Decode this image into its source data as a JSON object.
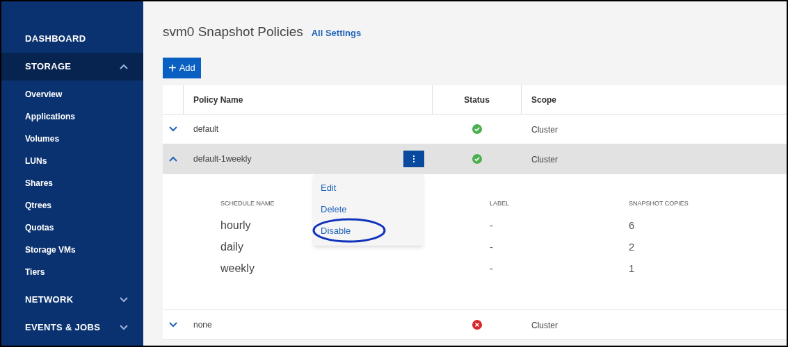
{
  "sidebar": {
    "sections": [
      {
        "label": "DASHBOARD",
        "selected": false
      },
      {
        "label": "STORAGE",
        "selected": true,
        "expanded": true,
        "items": [
          "Overview",
          "Applications",
          "Volumes",
          "LUNs",
          "Shares",
          "Qtrees",
          "Quotas",
          "Storage VMs",
          "Tiers"
        ]
      },
      {
        "label": "NETWORK",
        "selected": false,
        "expanded": false
      },
      {
        "label": "EVENTS & JOBS",
        "selected": false,
        "expanded": false
      }
    ]
  },
  "page": {
    "title": "svm0 Snapshot Policies",
    "link": "All Settings"
  },
  "add_button": {
    "icon": "+",
    "label": "Add"
  },
  "table": {
    "columns": [
      "Policy Name",
      "Status",
      "Scope"
    ],
    "rows": [
      {
        "name": "default",
        "healthy": true,
        "scope": "Cluster",
        "expanded": false,
        "selected": false
      },
      {
        "name": "default-1weekly",
        "healthy": true,
        "scope": "Cluster",
        "expanded": true,
        "selected": true,
        "menu": [
          {
            "label": "Edit",
            "circled": false
          },
          {
            "label": "Delete",
            "circled": false
          },
          {
            "label": "Disable",
            "circled": true
          }
        ],
        "details": {
          "columns": [
            "SCHEDULE NAME",
            "LABEL",
            "SNAPSHOT COPIES"
          ],
          "rows": [
            [
              "hourly",
              "-",
              "6"
            ],
            [
              "daily",
              "-",
              "2"
            ],
            [
              "weekly",
              "-",
              "1"
            ]
          ]
        }
      },
      {
        "name": "none",
        "healthy": false,
        "scope": "Cluster",
        "expanded": false,
        "selected": false
      }
    ]
  }
}
